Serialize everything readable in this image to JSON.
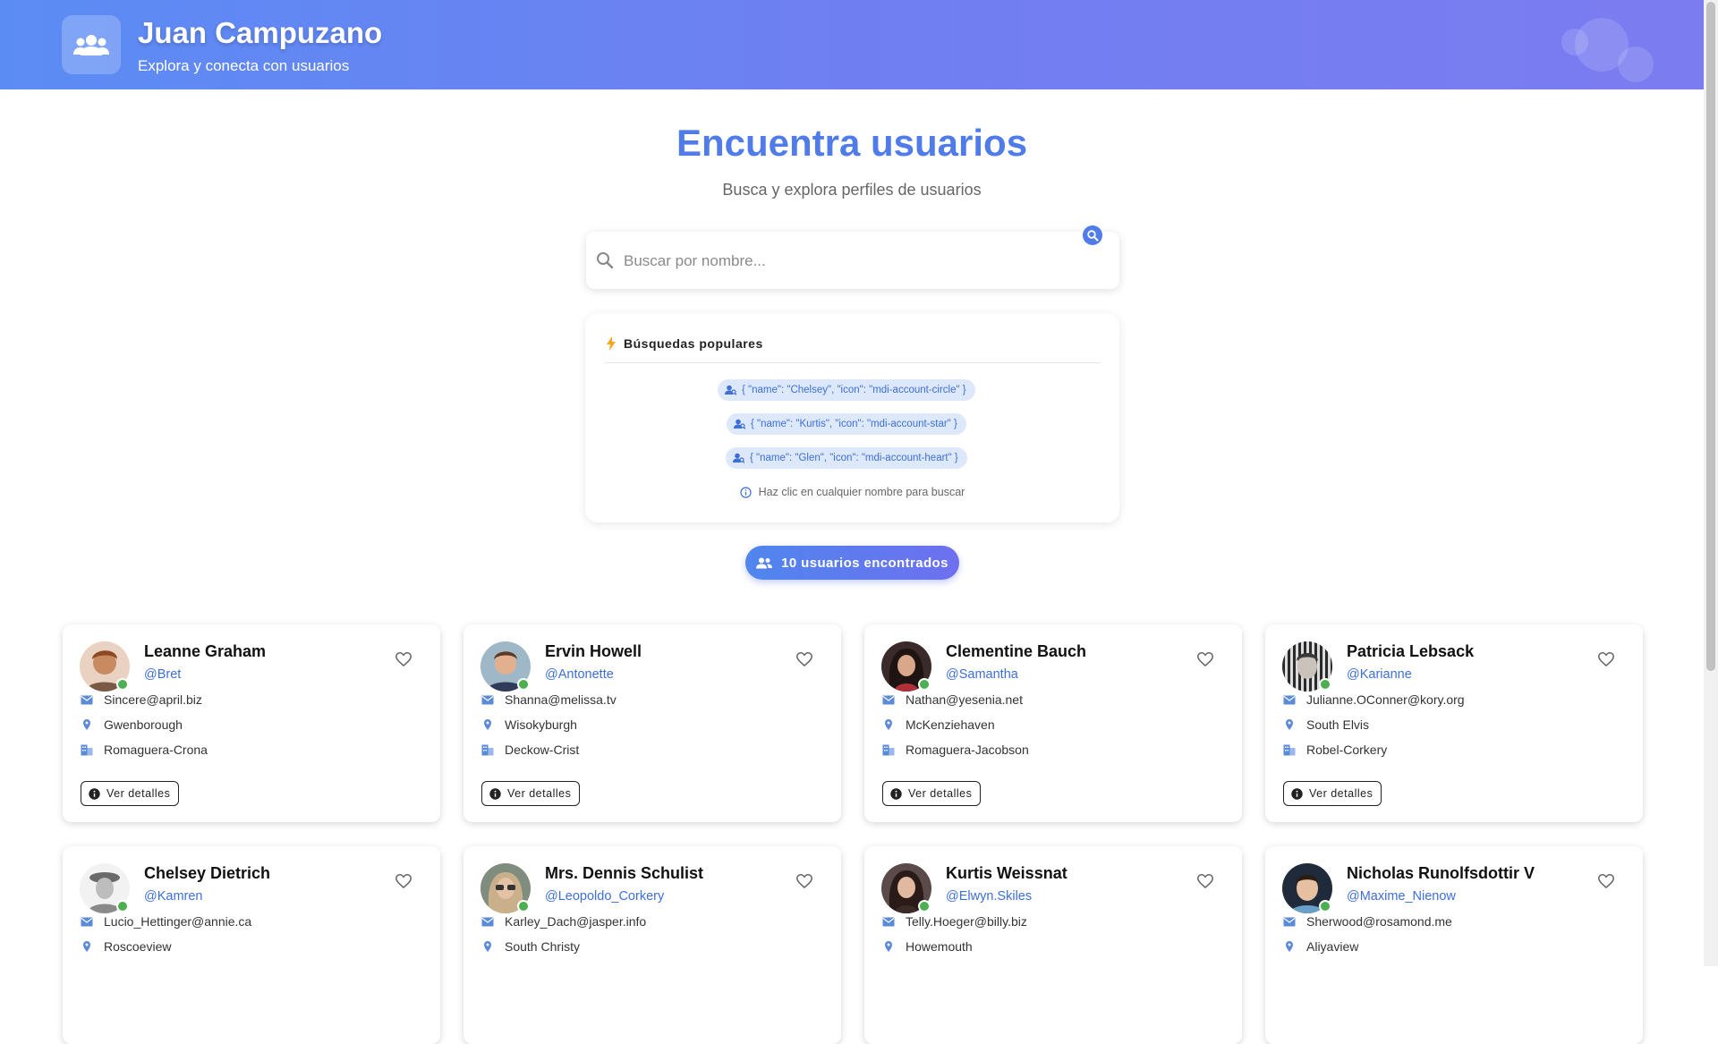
{
  "header": {
    "title": "Juan Campuzano",
    "subtitle": "Explora y conecta con usuarios",
    "logo_icon": "account-group-icon"
  },
  "hero": {
    "title": "Encuentra usuarios",
    "subtitle": "Busca y explora perfiles de usuarios"
  },
  "search": {
    "placeholder": "Buscar por nombre...",
    "value": ""
  },
  "popular": {
    "title": "Búsquedas populares",
    "chips": [
      {
        "label": "{ \"name\": \"Chelsey\", \"icon\": \"mdi-account-circle\" }"
      },
      {
        "label": "{ \"name\": \"Kurtis\", \"icon\": \"mdi-account-star\" }"
      },
      {
        "label": "{ \"name\": \"Glen\", \"icon\": \"mdi-account-heart\" }"
      }
    ],
    "hint": "Haz clic en cualquier nombre para buscar"
  },
  "results": {
    "count_label": "10 usuarios encontrados"
  },
  "colors": {
    "accent": "#4f7ce8",
    "online": "#4caf50",
    "link": "#3d6fd8"
  },
  "details_label": "Ver detalles",
  "users": [
    {
      "name": "Leanne Graham",
      "username": "@Bret",
      "email": "Sincere@april.biz",
      "city": "Gwenborough",
      "company": "Romaguera-Crona"
    },
    {
      "name": "Ervin Howell",
      "username": "@Antonette",
      "email": "Shanna@melissa.tv",
      "city": "Wisokyburgh",
      "company": "Deckow-Crist"
    },
    {
      "name": "Clementine Bauch",
      "username": "@Samantha",
      "email": "Nathan@yesenia.net",
      "city": "McKenziehaven",
      "company": "Romaguera-Jacobson"
    },
    {
      "name": "Patricia Lebsack",
      "username": "@Karianne",
      "email": "Julianne.OConner@kory.org",
      "city": "South Elvis",
      "company": "Robel-Corkery"
    },
    {
      "name": "Chelsey Dietrich",
      "username": "@Kamren",
      "email": "Lucio_Hettinger@annie.ca",
      "city": "Roscoeview"
    },
    {
      "name": "Mrs. Dennis Schulist",
      "username": "@Leopoldo_Corkery",
      "email": "Karley_Dach@jasper.info",
      "city": "South Christy"
    },
    {
      "name": "Kurtis Weissnat",
      "username": "@Elwyn.Skiles",
      "email": "Telly.Hoeger@billy.biz",
      "city": "Howemouth"
    },
    {
      "name": "Nicholas Runolfsdottir V",
      "username": "@Maxime_Nienow",
      "email": "Sherwood@rosamond.me",
      "city": "Aliyaview"
    }
  ]
}
